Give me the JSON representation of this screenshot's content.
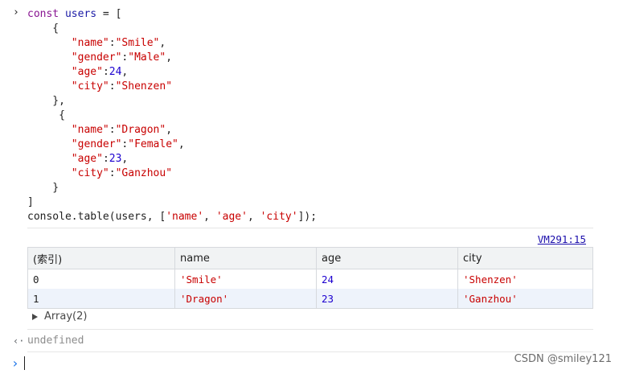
{
  "console": {
    "input_prompt": "›",
    "code_lines": [
      {
        "parts": [
          {
            "t": "kw",
            "v": "const"
          },
          {
            "t": "plain",
            "v": " "
          },
          {
            "t": "var",
            "v": "users"
          },
          {
            "t": "plain",
            "v": " = ["
          }
        ]
      },
      {
        "parts": [
          {
            "t": "plain",
            "v": "    {"
          }
        ]
      },
      {
        "parts": [
          {
            "t": "plain",
            "v": "       "
          },
          {
            "t": "key",
            "v": "\"name\""
          },
          {
            "t": "plain",
            "v": ":"
          },
          {
            "t": "val",
            "v": "\"Smile\""
          },
          {
            "t": "plain",
            "v": ","
          }
        ]
      },
      {
        "parts": [
          {
            "t": "plain",
            "v": "       "
          },
          {
            "t": "key",
            "v": "\"gender\""
          },
          {
            "t": "plain",
            "v": ":"
          },
          {
            "t": "val",
            "v": "\"Male\""
          },
          {
            "t": "plain",
            "v": ","
          }
        ]
      },
      {
        "parts": [
          {
            "t": "plain",
            "v": "       "
          },
          {
            "t": "key",
            "v": "\"age\""
          },
          {
            "t": "plain",
            "v": ":"
          },
          {
            "t": "numv",
            "v": "24"
          },
          {
            "t": "plain",
            "v": ","
          }
        ]
      },
      {
        "parts": [
          {
            "t": "plain",
            "v": "       "
          },
          {
            "t": "key",
            "v": "\"city\""
          },
          {
            "t": "plain",
            "v": ":"
          },
          {
            "t": "val",
            "v": "\"Shenzen\""
          }
        ]
      },
      {
        "parts": [
          {
            "t": "plain",
            "v": "    },"
          }
        ]
      },
      {
        "parts": [
          {
            "t": "plain",
            "v": "     {"
          }
        ]
      },
      {
        "parts": [
          {
            "t": "plain",
            "v": "       "
          },
          {
            "t": "key",
            "v": "\"name\""
          },
          {
            "t": "plain",
            "v": ":"
          },
          {
            "t": "val",
            "v": "\"Dragon\""
          },
          {
            "t": "plain",
            "v": ","
          }
        ]
      },
      {
        "parts": [
          {
            "t": "plain",
            "v": "       "
          },
          {
            "t": "key",
            "v": "\"gender\""
          },
          {
            "t": "plain",
            "v": ":"
          },
          {
            "t": "val",
            "v": "\"Female\""
          },
          {
            "t": "plain",
            "v": ","
          }
        ]
      },
      {
        "parts": [
          {
            "t": "plain",
            "v": "       "
          },
          {
            "t": "key",
            "v": "\"age\""
          },
          {
            "t": "plain",
            "v": ":"
          },
          {
            "t": "numv",
            "v": "23"
          },
          {
            "t": "plain",
            "v": ","
          }
        ]
      },
      {
        "parts": [
          {
            "t": "plain",
            "v": "       "
          },
          {
            "t": "key",
            "v": "\"city\""
          },
          {
            "t": "plain",
            "v": ":"
          },
          {
            "t": "val",
            "v": "\"Ganzhou\""
          }
        ]
      },
      {
        "parts": [
          {
            "t": "plain",
            "v": "    }"
          }
        ]
      },
      {
        "parts": [
          {
            "t": "plain",
            "v": "]"
          }
        ]
      },
      {
        "parts": [
          {
            "t": "plain",
            "v": "console.table(users, ["
          },
          {
            "t": "val",
            "v": "'name'"
          },
          {
            "t": "plain",
            "v": ", "
          },
          {
            "t": "val",
            "v": "'age'"
          },
          {
            "t": "plain",
            "v": ", "
          },
          {
            "t": "val",
            "v": "'city'"
          },
          {
            "t": "plain",
            "v": "]);"
          }
        ]
      }
    ],
    "source_link": "VM291:15",
    "table": {
      "headers": [
        "(索引)",
        "name",
        "age",
        "city"
      ],
      "rows": [
        [
          "0",
          "'Smile'",
          "24",
          "'Shenzen'"
        ],
        [
          "1",
          "'Dragon'",
          "23",
          "'Ganzhou'"
        ]
      ]
    },
    "array_summary": "Array(2)",
    "return_value": "undefined",
    "return_arrow": "‹·",
    "input_chevron": "›"
  },
  "watermark": "CSDN @smiley121",
  "colors": {
    "keyword": "#881391",
    "variable": "#1a1aa6",
    "string": "#c80000",
    "number": "#1c00cf",
    "link": "#1a0dab",
    "header_bg": "#f1f3f4",
    "alt_row_bg": "#eef3fb",
    "prompt_accent": "#1a73e8"
  }
}
